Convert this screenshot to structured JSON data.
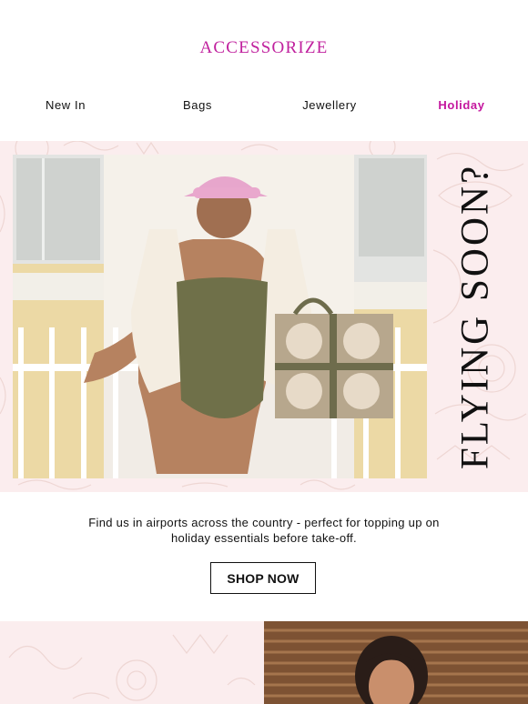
{
  "brand": {
    "logo_text": "ACCESSORIZE"
  },
  "nav": {
    "items": [
      {
        "label": "New In"
      },
      {
        "label": "Bags"
      },
      {
        "label": "Jewellery"
      },
      {
        "label": "Holiday"
      }
    ]
  },
  "hero": {
    "headline": "FLYING SOON?"
  },
  "body": {
    "copy": "Find us in airports across the country - perfect for topping up on holiday essentials before take-off.",
    "cta_label": "SHOP NOW"
  },
  "colors": {
    "brand": "#c0219e",
    "hero_background": "#fbedee",
    "text": "#111111",
    "cta_border": "#111111"
  }
}
